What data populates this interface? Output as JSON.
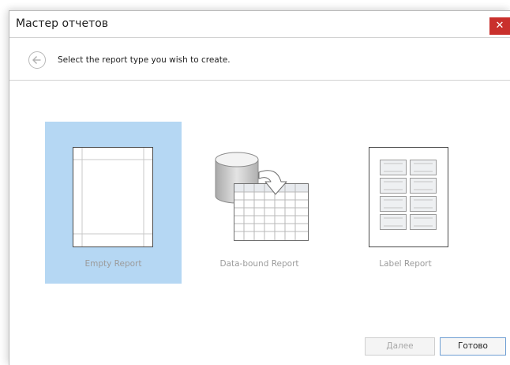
{
  "window": {
    "title": "Мастер отчетов",
    "close_label": "✕"
  },
  "header": {
    "instruction": "Select the report type you wish to create."
  },
  "report_types": [
    {
      "label": "Empty Report",
      "icon": "empty-report-icon",
      "selected": true
    },
    {
      "label": "Data-bound Report",
      "icon": "data-bound-report-icon",
      "selected": false
    },
    {
      "label": "Label Report",
      "icon": "label-report-icon",
      "selected": false
    }
  ],
  "footer": {
    "next_label": "Далее",
    "next_enabled": false,
    "finish_label": "Готово"
  },
  "colors": {
    "selection": "#b5d7f3",
    "close_button": "#c9302c",
    "focus_border": "#6f9fd3"
  }
}
